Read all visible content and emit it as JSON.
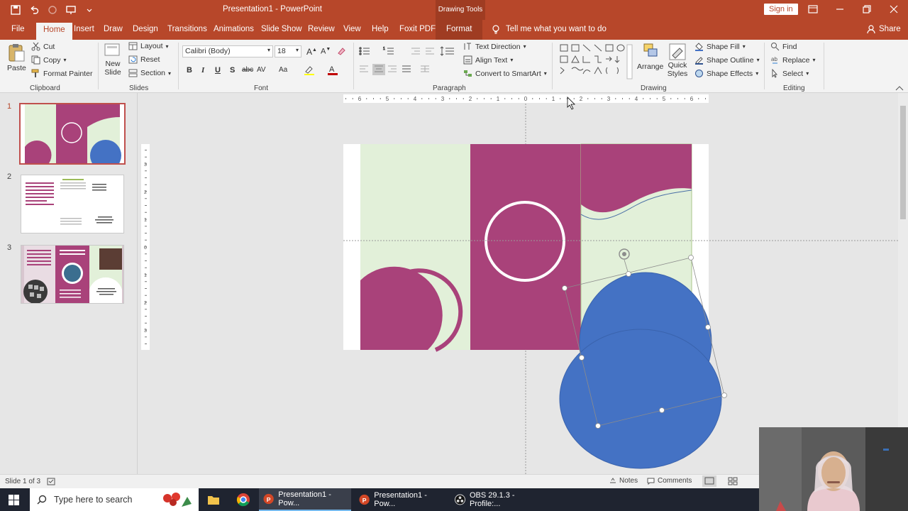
{
  "window": {
    "title": "Presentation1 - PowerPoint",
    "contextual_tab_header": "Drawing Tools",
    "sign_in": "Sign in",
    "share": "Share"
  },
  "tabs": [
    "File",
    "Home",
    "Insert",
    "Draw",
    "Design",
    "Transitions",
    "Animations",
    "Slide Show",
    "Review",
    "View",
    "Help",
    "Foxit PDF",
    "Format"
  ],
  "active_tab": "Home",
  "tell_me": "Tell me what you want to do",
  "ribbon": {
    "clipboard": {
      "label": "Clipboard",
      "paste": "Paste",
      "cut": "Cut",
      "copy": "Copy",
      "format_painter": "Format Painter"
    },
    "slides": {
      "label": "Slides",
      "new_slide_line1": "New",
      "new_slide_line2": "Slide",
      "layout": "Layout",
      "reset": "Reset",
      "section": "Section"
    },
    "font": {
      "label": "Font",
      "font_name": "Calibri (Body)",
      "font_size": "18",
      "bold": "B",
      "italic": "I",
      "underline": "U",
      "shadow": "S",
      "strike": "abc",
      "spacing": "AV",
      "case": "Aa"
    },
    "paragraph": {
      "label": "Paragraph",
      "text_direction": "Text Direction",
      "align_text": "Align Text",
      "convert_smartart": "Convert to SmartArt"
    },
    "drawing": {
      "label": "Drawing",
      "arrange": "Arrange",
      "quick_styles_line1": "Quick",
      "quick_styles_line2": "Styles",
      "shape_fill": "Shape Fill",
      "shape_outline": "Shape Outline",
      "shape_effects": "Shape Effects"
    },
    "editing": {
      "label": "Editing",
      "find": "Find",
      "replace": "Replace",
      "select": "Select"
    }
  },
  "thumbnails": [
    {
      "number": "1",
      "selected": true
    },
    {
      "number": "2",
      "selected": false
    },
    {
      "number": "3",
      "selected": false
    }
  ],
  "ruler_h_labels": [
    "6",
    "5",
    "4",
    "3",
    "2",
    "1",
    "0",
    "1",
    "2",
    "3",
    "4",
    "5",
    "6"
  ],
  "ruler_v_labels": [
    "3",
    "2",
    "1",
    "0",
    "1",
    "2",
    "3"
  ],
  "status": {
    "slide_info": "Slide 1 of 3",
    "notes": "Notes",
    "comments": "Comments"
  },
  "taskbar": {
    "search_placeholder": "Type here to search",
    "items": [
      "Presentation1 - Pow...",
      "Presentation1 - Pow...",
      "OBS 29.1.3 - Profile:..."
    ]
  },
  "colors": {
    "accent": "#b7472a",
    "slide_magenta": "#a9427a",
    "slide_green": "#e2f0d9",
    "shape_blue": "#4472c4"
  }
}
